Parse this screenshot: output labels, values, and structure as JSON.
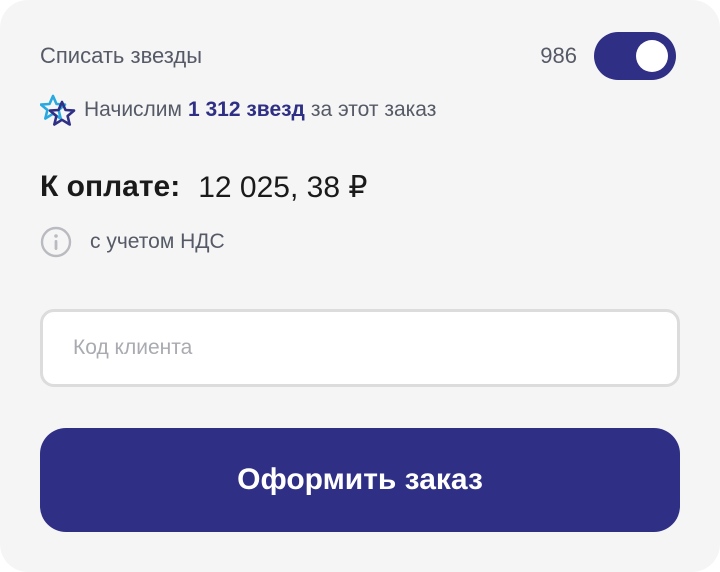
{
  "stars": {
    "label": "Списать звезды",
    "count": "986",
    "toggle_on": true
  },
  "bonus": {
    "prefix": "Начислим",
    "amount": "1 312 звезд",
    "suffix": "за этот заказ",
    "icon": "star-icon"
  },
  "total": {
    "label": "К оплате:",
    "value": "12 025, 38 ₽"
  },
  "vat": {
    "icon": "info-icon",
    "text": "с учетом НДС"
  },
  "client_code": {
    "placeholder": "Код клиента",
    "value": ""
  },
  "submit": {
    "label": "Оформить заказ"
  },
  "colors": {
    "accent": "#2e2f85",
    "star_light": "#29a9e0",
    "background": "#f5f5f5",
    "muted_text": "#555a66"
  }
}
